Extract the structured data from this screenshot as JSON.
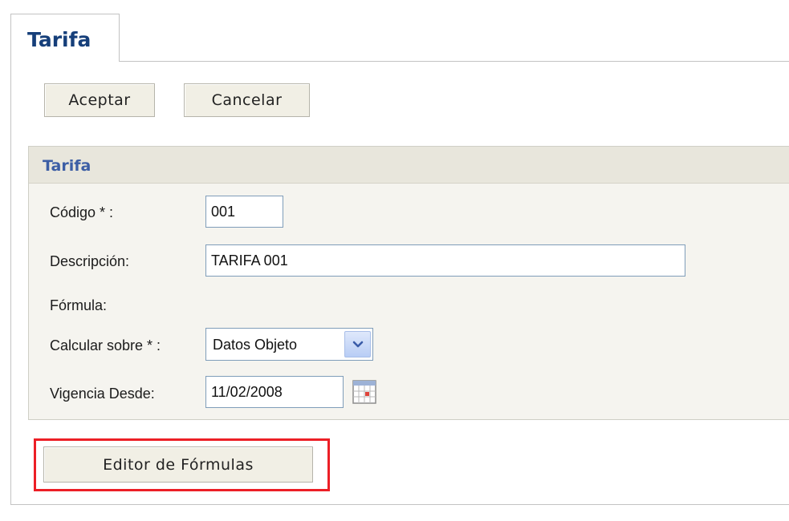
{
  "tab": {
    "title": "Tarifa"
  },
  "toolbar": {
    "accept_label": "Aceptar",
    "cancel_label": "Cancelar"
  },
  "form": {
    "section_title": "Tarifa",
    "fields": {
      "codigo": {
        "label": "Código * :",
        "value": "001"
      },
      "descripcion": {
        "label": "Descripción:",
        "value": "TARIFA 001"
      },
      "formula": {
        "label": "Fórmula:"
      },
      "calcular": {
        "label": "Calcular sobre * :",
        "value": "Datos Objeto"
      },
      "vigencia": {
        "label": "Vigencia Desde:",
        "value": "11/02/2008"
      }
    }
  },
  "editor_button": {
    "label": "Editor de Fórmulas"
  },
  "colors": {
    "highlight": "#ec1f26",
    "tab_title": "#163f7a",
    "section_title": "#3c5ea5"
  },
  "icons": {
    "dropdown": "chevron-down-icon",
    "date_picker": "calendar-icon"
  }
}
